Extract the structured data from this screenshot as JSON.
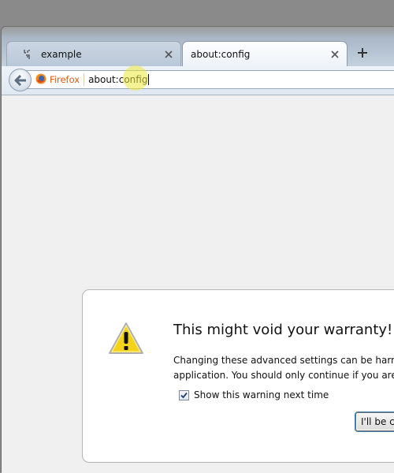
{
  "tabs": [
    {
      "label": "example",
      "icon": "puzzle-icon",
      "active": false
    },
    {
      "label": "about:config",
      "icon": "",
      "active": true
    }
  ],
  "navbar": {
    "back_icon": "back-arrow-icon",
    "identity_label": "Firefox",
    "url": "about:config"
  },
  "dialog": {
    "title": "This might void your warranty!",
    "body_line1": "Changing these advanced settings can be harmful to the stability, security, and performance of this",
    "body_line2": "application. You should only continue if you are sure of what you are doing.",
    "checkbox_label": "Show this warning next time",
    "checkbox_checked": true,
    "button_label": "I'll be careful, I promise!"
  },
  "colors": {
    "identity": "#e0590b",
    "button_focus": "#3c7fb1",
    "warning_yellow": "#f3d21a"
  }
}
